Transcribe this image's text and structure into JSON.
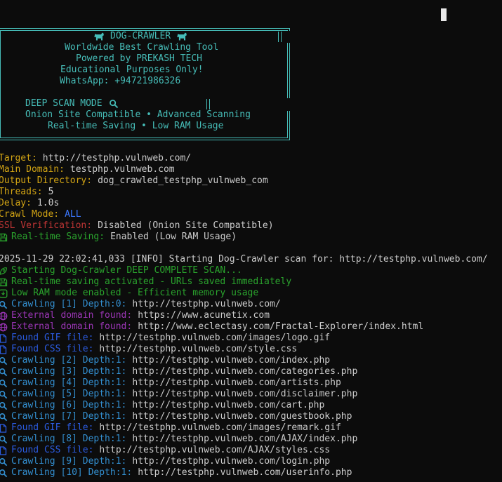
{
  "colors": {
    "bg": "#0c0c0c",
    "fg": "#cccccc",
    "teal": "#46bdb8",
    "yellow": "#d2a414",
    "red": "#bf3535",
    "green": "#2aa32d",
    "blue": "#3b78ff",
    "cyan": "#338fd0",
    "purple": "#9a35b5",
    "fileblue": "#2b5be0",
    "cursor": "#e8e8e8"
  },
  "banner": {
    "title": "DOG-CRAWLER",
    "tagline1": "Worldwide Best Crawling Tool",
    "tagline2": "Powered by PREKASH TECH",
    "tagline3": "Educational Purposes Only!",
    "tagline4": "WhatsApp: +94721986326",
    "mode_heading": "DEEP SCAN MODE",
    "feature1": "Onion Site Compatible • Advanced Scanning",
    "feature2": "Real-time Saving • Low RAM Usage"
  },
  "config": {
    "rows": [
      {
        "label": "Target:",
        "value": "http://testphp.vulnweb.com/"
      },
      {
        "label": "Main Domain:",
        "value": "testphp.vulnweb.com"
      },
      {
        "label": "Output Directory:",
        "value": "dog_crawled_testphp_vulnweb_com"
      },
      {
        "label": "Threads:",
        "value": "5"
      },
      {
        "label": "Delay:",
        "value": "1.0s"
      },
      {
        "label": "Crawl Mode:",
        "value": "ALL"
      },
      {
        "label": "SSL Verification:",
        "value": "Disabled (Onion Site Compatible)"
      },
      {
        "label": "Real-time Saving:",
        "value": "Enabled (Low RAM Usage)"
      }
    ]
  },
  "log": {
    "rows": [
      {
        "text": "2025-11-29 22:02:41,033 [INFO] Starting Dog-Crawler scan for: http://testphp.vulnweb.com/"
      },
      {
        "text": "Starting Dog-Crawler DEEP COMPLETE SCAN..."
      },
      {
        "text": "Real-time saving activated - URLs saved immediately"
      },
      {
        "text": "Low RAM mode enabled - Efficient memory usage"
      },
      {
        "label": "Crawling [1] Depth:0:",
        "url": "http://testphp.vulnweb.com/"
      },
      {
        "label": "External domain found:",
        "url": "https://www.acunetix.com"
      },
      {
        "label": "External domain found:",
        "url": "http://www.eclectasy.com/Fractal-Explorer/index.html"
      },
      {
        "label": "Found GIF file:",
        "url": "http://testphp.vulnweb.com/images/logo.gif"
      },
      {
        "label": "Found CSS file:",
        "url": "http://testphp.vulnweb.com/style.css"
      },
      {
        "label": "Crawling [2] Depth:1:",
        "url": "http://testphp.vulnweb.com/index.php"
      },
      {
        "label": "Crawling [3] Depth:1:",
        "url": "http://testphp.vulnweb.com/categories.php"
      },
      {
        "label": "Crawling [4] Depth:1:",
        "url": "http://testphp.vulnweb.com/artists.php"
      },
      {
        "label": "Crawling [5] Depth:1:",
        "url": "http://testphp.vulnweb.com/disclaimer.php"
      },
      {
        "label": "Crawling [6] Depth:1:",
        "url": "http://testphp.vulnweb.com/cart.php"
      },
      {
        "label": "Crawling [7] Depth:1:",
        "url": "http://testphp.vulnweb.com/guestbook.php"
      },
      {
        "label": "Found GIF file:",
        "url": "http://testphp.vulnweb.com/images/remark.gif"
      },
      {
        "label": "Crawling [8] Depth:1:",
        "url": "http://testphp.vulnweb.com/AJAX/index.php"
      },
      {
        "label": "Found CSS file:",
        "url": "http://testphp.vulnweb.com/AJAX/styles.css"
      },
      {
        "label": "Crawling [9] Depth:1:",
        "url": "http://testphp.vulnweb.com/login.php"
      },
      {
        "label": "Crawling [10] Depth:1:",
        "url": "http://testphp.vulnweb.com/userinfo.php"
      }
    ]
  }
}
